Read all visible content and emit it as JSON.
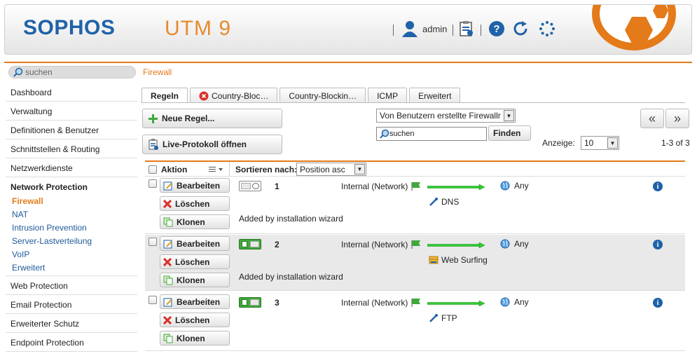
{
  "header": {
    "brand": "SOPHOS",
    "product": "UTM 9",
    "user": "admin",
    "icons": [
      "user-icon",
      "clipboard-icon",
      "help-icon",
      "reload-icon",
      "spinner-icon"
    ]
  },
  "nav": {
    "search_placeholder": "suchen",
    "items": [
      "Dashboard",
      "Verwaltung",
      "Definitionen & Benutzer",
      "Schnittstellen & Routing",
      "Netzwerkdienste"
    ],
    "section": "Network Protection",
    "sub_items": [
      "Firewall",
      "NAT",
      "Intrusion Prevention",
      "Server-Lastverteilung",
      "VoIP",
      "Erweitert"
    ],
    "items_after": [
      "Web Protection",
      "Email Protection",
      "Erweiterter Schutz",
      "Endpoint Protection"
    ]
  },
  "breadcrumb": "Firewall",
  "tabs": [
    "Regeln",
    "Country-Bloc…",
    "Country-Blockin…",
    "ICMP",
    "Erweitert"
  ],
  "toolbar": {
    "new_rule": "Neue Regel...",
    "live_log": "Live-Protokoll öffnen",
    "filter_select": "Von Benutzern erstellte Firewallr",
    "search_value": "suchen",
    "find_button": "Finden",
    "display_label": "Anzeige:",
    "display_value": "10",
    "range": "1-3 of 3",
    "prev": "«",
    "next": "»"
  },
  "list": {
    "action_header": "Aktion",
    "sort_label": "Sortieren nach:",
    "sort_value": "Position asc",
    "edit_label": "Bearbeiten",
    "delete_label": "Löschen",
    "clone_label": "Klonen",
    "rows": [
      {
        "number": "1",
        "source": "Internal (Network)",
        "destination": "Any",
        "service": "DNS",
        "comment": "Added by installation wizard",
        "enabled": false
      },
      {
        "number": "2",
        "source": "Internal (Network)",
        "destination": "Any",
        "service": "Web Surfing",
        "comment": "Added by installation wizard",
        "enabled": true
      },
      {
        "number": "3",
        "source": "Internal (Network)",
        "destination": "Any",
        "service": "FTP",
        "comment": "",
        "enabled": true
      }
    ]
  },
  "colors": {
    "accent": "#e47a1a",
    "brand": "#1f62a8",
    "toggle_on": "#3fa83a"
  }
}
